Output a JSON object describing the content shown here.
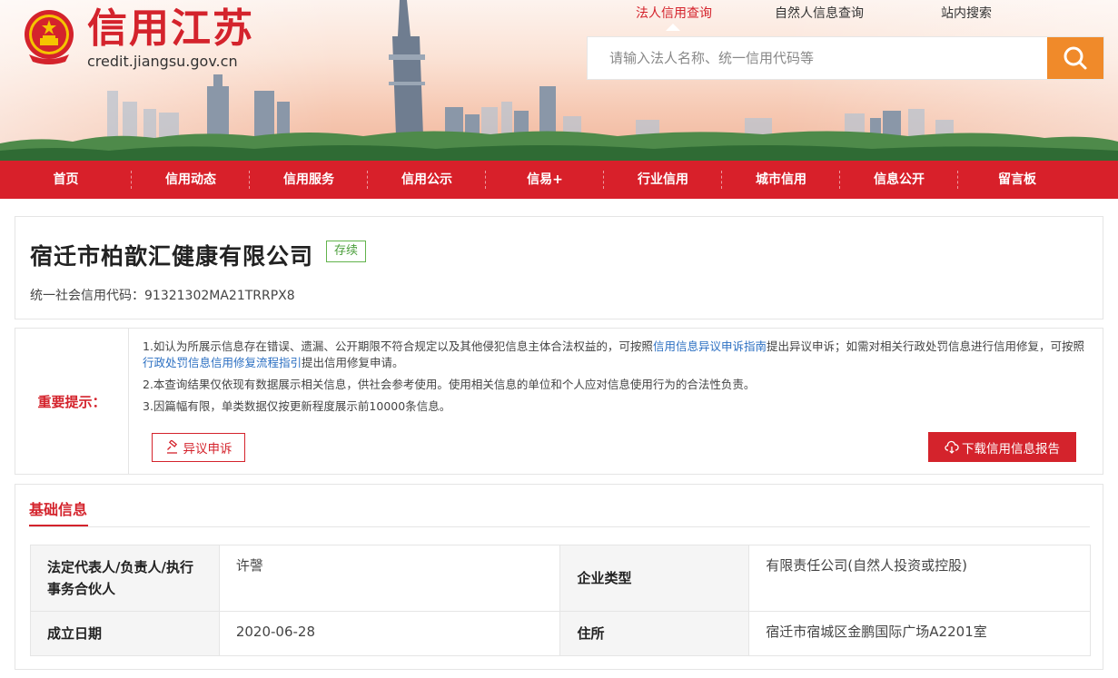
{
  "site": {
    "title": "信用江苏",
    "domain": "credit.jiangsu.gov.cn"
  },
  "search": {
    "tabs": [
      "法人信用查询",
      "自然人信息查询",
      "站内搜索"
    ],
    "active_tab": "法人信用查询",
    "placeholder": "请输入法人名称、统一信用代码等",
    "button_color": "#f08a2a"
  },
  "nav": {
    "items": [
      "首页",
      "信用动态",
      "信用服务",
      "信用公示",
      "信易+",
      "行业信用",
      "城市信用",
      "信息公开",
      "留言板"
    ],
    "color": "#d8202a"
  },
  "company": {
    "name": "宿迁市柏歆汇健康有限公司",
    "status": "存续",
    "credit_code_label": "统一社会信用代码：",
    "credit_code": "91321302MA21TRRPX8"
  },
  "notice": {
    "label": "重要提示：",
    "item1_pre": "1.如认为所展示信息存在错误、遗漏、公开期限不符合规定以及其他侵犯信息主体合法权益的，可按照",
    "item1_link1": "信用信息异议申诉指南",
    "item1_mid": "提出异议申诉；如需对相关行政处罚信息进行信用修复，可按照",
    "item1_link2": "行政处罚信息信用修复流程指引",
    "item1_post": "提出信用修复申请。",
    "item2": "2.本查询结果仅依现有数据展示相关信息，供社会参考使用。使用相关信息的单位和个人应对信息使用行为的合法性负责。",
    "item3": "3.因篇幅有限，单类数据仅按更新程度展示前10000条信息。",
    "appeal_button": "异议申诉",
    "download_button": "下载信用信息报告"
  },
  "basic_info": {
    "title": "基础信息",
    "rows": [
      [
        {
          "key": "法定代表人/负责人/执行事务合伙人",
          "value": "许謦"
        },
        {
          "key": "企业类型",
          "value": "有限责任公司(自然人投资或控股)"
        }
      ],
      [
        {
          "key": "成立日期",
          "value": "2020-06-28"
        },
        {
          "key": "住所",
          "value": "宿迁市宿城区金鹏国际广场A2201室"
        }
      ]
    ]
  },
  "colors": {
    "brand_red": "#d4232c",
    "link_blue": "#2b6fc2",
    "status_green": "#4a9e3a"
  }
}
